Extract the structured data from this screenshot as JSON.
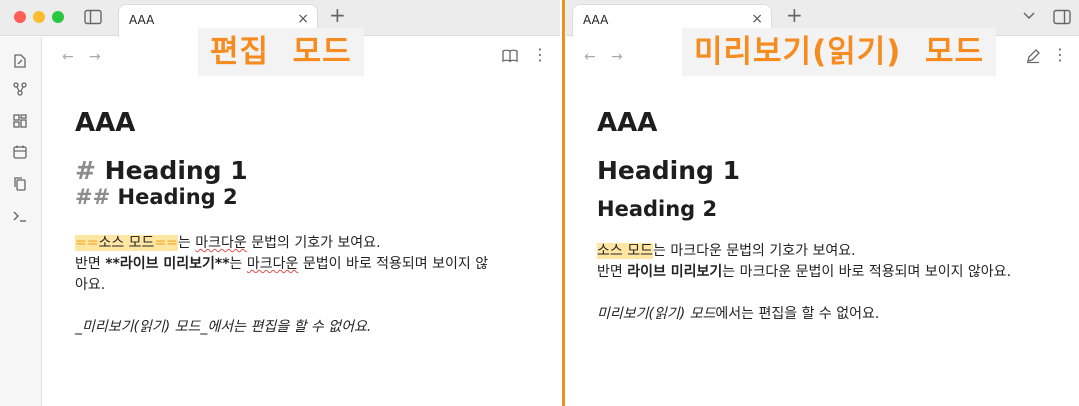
{
  "left": {
    "tab_title": "AAA",
    "mode_label": "편집  모드",
    "doc_title": "AAA",
    "h1_hash": "#",
    "h1": "Heading 1",
    "h2_hash": "##",
    "h2": "Heading 2",
    "p1_mark_open": "==",
    "p1_highlight": "소스 모드",
    "p1_mark_close": "==",
    "p1_suffix": "는 ",
    "p1_spell": "마크다운",
    "p1_rest": " 문법의 기호가 보여요.",
    "p2_prefix": "반면 ",
    "p2_bold": "**라이브 미리보기**",
    "p2_mid": "는 ",
    "p2_spell": "마크다운",
    "p2_rest": " 문법이 바로 적용되며 보이지 않",
    "p2_wrap": "아요.",
    "p3": "_미리보기(읽기) 모드_에서는 편집을 할 수 없어요."
  },
  "right": {
    "tab_title": "AAA",
    "mode_label": "미리보기(읽기)  모드",
    "doc_title": "AAA",
    "h1": "Heading 1",
    "h2": "Heading 2",
    "p1_highlight": "소스 모드",
    "p1_rest": "는 마크다운 문법의 기호가 보여요.",
    "p2_prefix": "반면 ",
    "p2_bold": "라이브 미리보기",
    "p2_rest": "는 마크다운 문법이 바로 적용되며 보이지 않아요.",
    "p3_italic": "미리보기(읽기) 모드",
    "p3_rest": "에서는 편집을 할 수 없어요."
  },
  "icons": {
    "close": "×",
    "plus": "+",
    "chevron": "⌄",
    "more": "⋮",
    "back": "←",
    "forward": "→"
  },
  "colors": {
    "accent": "#f68b1f",
    "highlight": "#ffe7a3"
  }
}
